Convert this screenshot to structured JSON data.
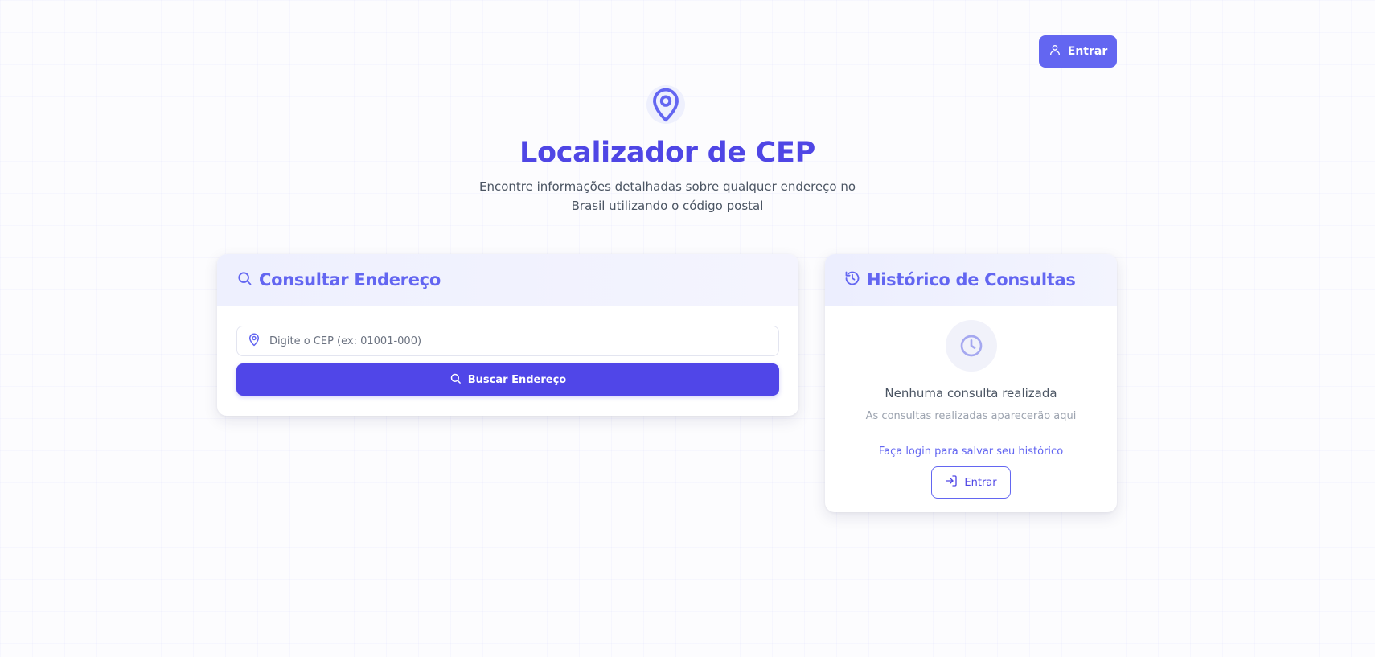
{
  "header": {
    "login_label": "Entrar",
    "login_icon": "user-icon"
  },
  "hero": {
    "icon": "map-pin-icon",
    "title": "Localizador de CEP",
    "subtitle": "Encontre informações detalhadas sobre qualquer endereço no Brasil utilizando o código postal"
  },
  "search": {
    "title": "Consultar Endereço",
    "title_icon": "search-icon",
    "input_icon": "map-pin-icon",
    "placeholder": "Digite o CEP (ex: 01001-000)",
    "value": "",
    "button_label": "Buscar Endereço",
    "button_icon": "search-icon"
  },
  "history": {
    "title": "Histórico de Consultas",
    "title_icon": "history-icon",
    "empty_icon": "clock-icon",
    "empty_title": "Nenhuma consulta realizada",
    "empty_description": "As consultas realizadas aparecerão aqui",
    "login_prompt": "Faça login para salvar seu histórico",
    "login_label": "Entrar",
    "login_icon": "log-in-icon"
  },
  "colors": {
    "primary": "#6366f1",
    "primary_dark": "#4f46e5",
    "button": "#5046e8"
  }
}
